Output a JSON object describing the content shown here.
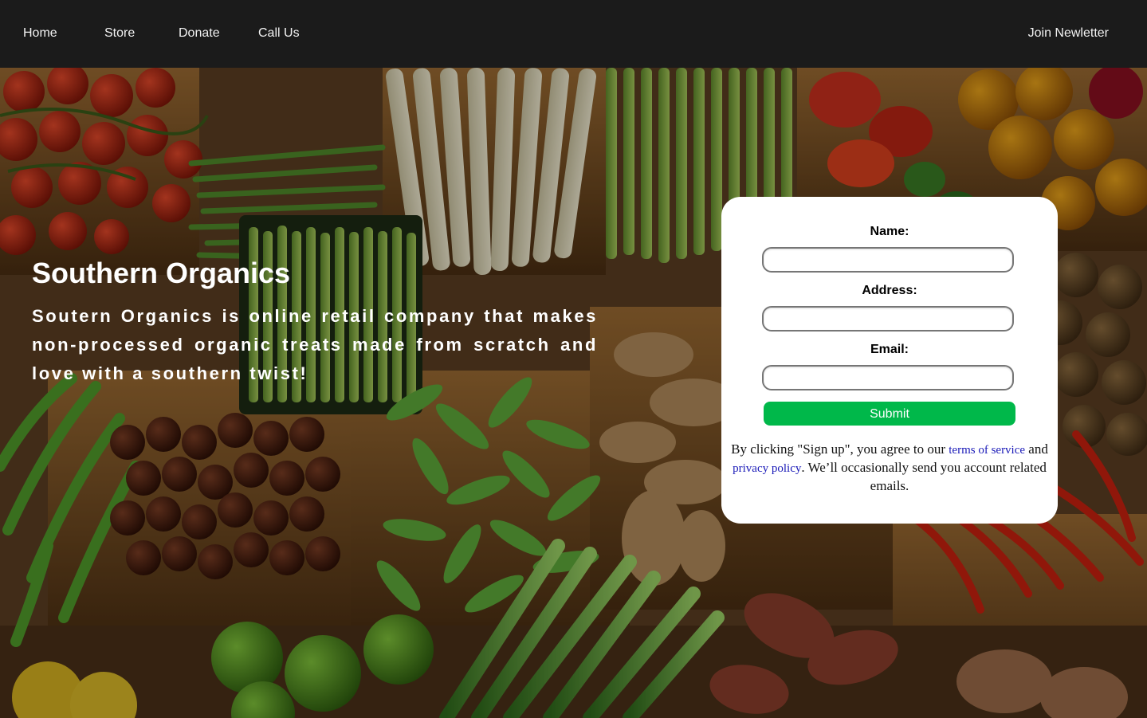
{
  "nav": {
    "home": "Home",
    "store": "Store",
    "donate": "Donate",
    "call_us": "Call Us",
    "join_newsletter": "Join Newletter"
  },
  "hero": {
    "title": "Southern Organics",
    "description": "Soutern Organics is online retail company that makes non-processed organic treats made from scratch and love with a southern twist!"
  },
  "form": {
    "name_label": "Name:",
    "name_value": "",
    "address_label": "Address:",
    "address_value": "",
    "email_label": "Email:",
    "email_value": "",
    "submit_label": "Submit",
    "legal_prefix": "By clicking \"Sign up\", you agree to our ",
    "terms_link": "terms of service",
    "legal_middle": " and ",
    "privacy_link": "privacy policy",
    "legal_suffix": ". We’ll occasionally send you account related emails."
  },
  "colors": {
    "navbar_bg": "#1b1b1b",
    "submit_bg": "#00b84a",
    "link": "#1a1ab8"
  }
}
